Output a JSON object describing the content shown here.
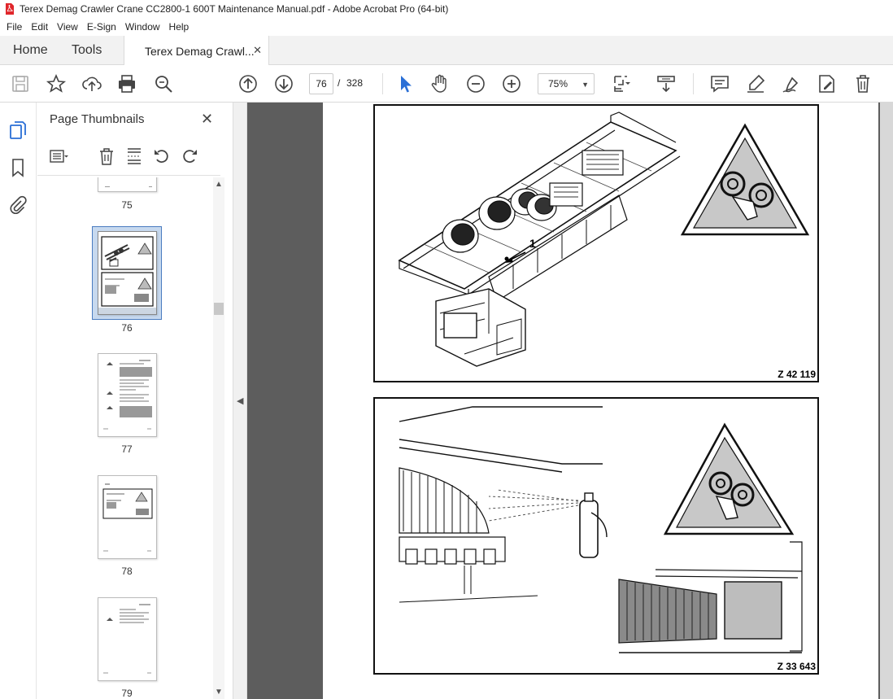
{
  "window": {
    "title": "Terex Demag Crawler Crane CC2800-1 600T Maintenance Manual.pdf - Adobe Acrobat Pro (64-bit)"
  },
  "menu": [
    "File",
    "Edit",
    "View",
    "E-Sign",
    "Window",
    "Help"
  ],
  "tabs": {
    "home": "Home",
    "tools": "Tools",
    "document": "Terex Demag Crawl...",
    "close": "✕"
  },
  "toolbar": {
    "current_page": "76",
    "page_separator": "/",
    "total_pages": "328",
    "zoom": "75%"
  },
  "thumbnails_panel": {
    "title": "Page Thumbnails",
    "close": "✕",
    "pages": [
      {
        "number": "75"
      },
      {
        "number": "76",
        "selected": true
      },
      {
        "number": "77"
      },
      {
        "number": "78"
      },
      {
        "number": "79"
      }
    ]
  },
  "document": {
    "figures": [
      {
        "label": "Z 42 119",
        "callout": "1"
      },
      {
        "label": "Z 33 643"
      }
    ]
  },
  "icons": {
    "toolbar": [
      "save-icon",
      "bookmark-star-icon",
      "upload-icon",
      "print-icon",
      "zoom-search-icon",
      "prev-page-icon",
      "next-page-icon",
      "select-cursor-icon",
      "hand-icon",
      "zoom-out-icon",
      "zoom-in-icon",
      "fit-page-icon",
      "scroll-mode-icon",
      "comment-icon",
      "highlight-icon",
      "sign-icon",
      "edit-pdf-icon",
      "delete-icon"
    ],
    "rail": [
      "page-thumbnails-icon",
      "bookmarks-icon",
      "attachments-icon"
    ]
  }
}
